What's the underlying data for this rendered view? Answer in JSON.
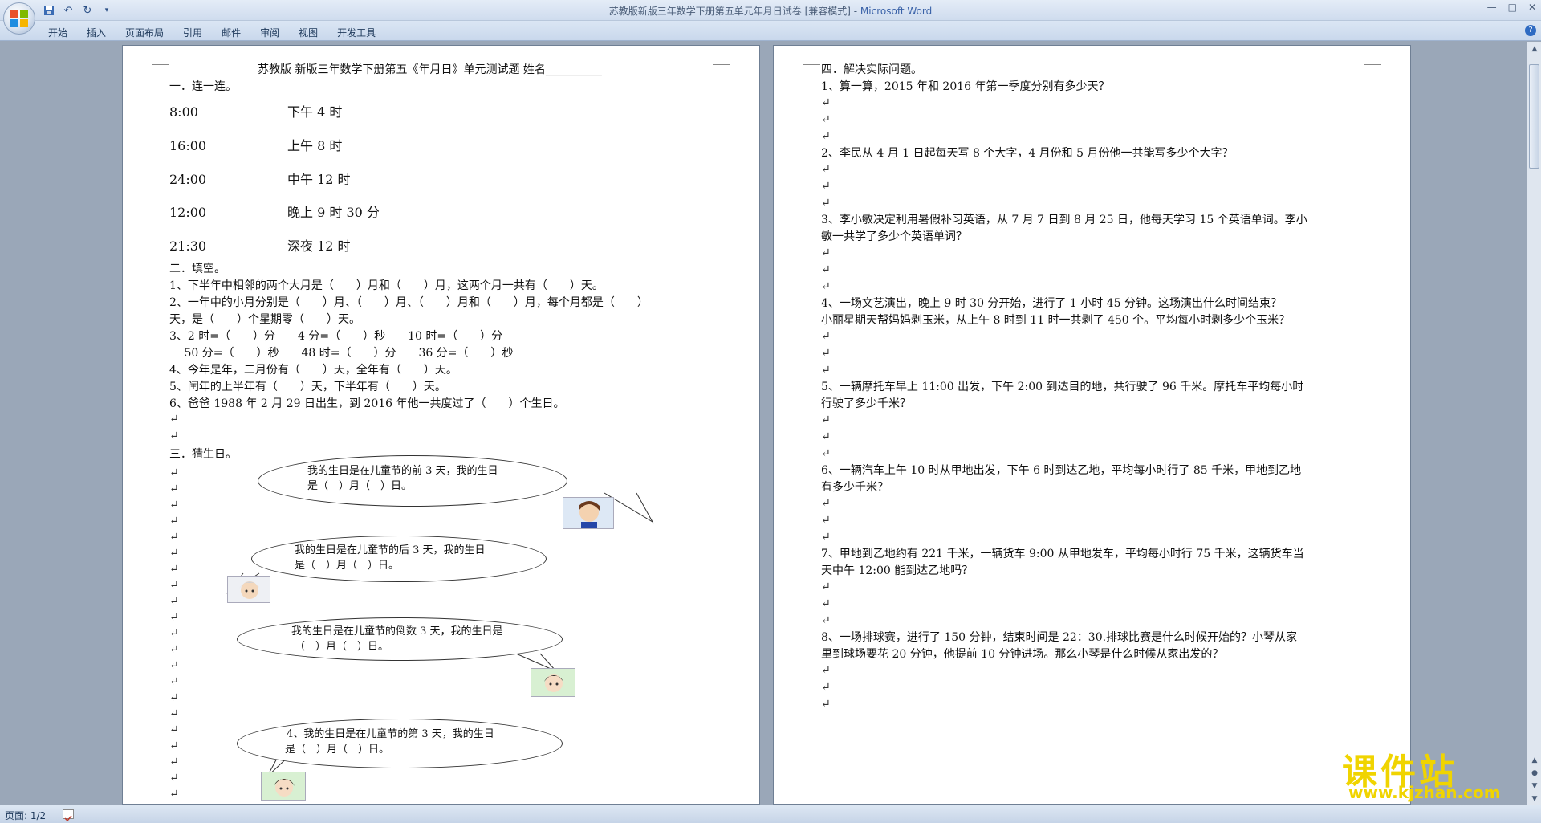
{
  "window": {
    "title_doc": "苏教版新版三年数学下册第五单元年月日试卷 [兼容模式] - ",
    "title_app": "Microsoft Word",
    "controls": [
      "—",
      "□",
      "✕"
    ]
  },
  "ribbon": {
    "tabs": [
      "开始",
      "插入",
      "页面布局",
      "引用",
      "邮件",
      "审阅",
      "视图",
      "开发工具"
    ]
  },
  "page1": {
    "title": "苏教版 新版三年数学下册第五《年月日》单元测试题      姓名__________",
    "sec1": "一．连一连。",
    "match_left": [
      "8:00",
      "16:00",
      "24:00",
      "12:00",
      "21:30"
    ],
    "match_right": [
      "下午 4 时",
      "上午 8 时",
      "中午 12 时",
      "晚上 9 时 30 分",
      "深夜 12 时"
    ],
    "sec2": "二．填空。",
    "fill": [
      "1、下半年中相邻的两个大月是（　　）月和（　　）月，这两个月一共有（　　）天。",
      "2、一年中的小月分别是（　　）月、（　　）月、（　　）月和（　　）月，每个月都是（　　）",
      "天，是（　　）个星期零（　　）天。",
      "3、2 时=（　　）分　　4 分=（　　）秒　　10 时=（　　）分",
      "　 50 分=（　　）秒　　48 时=（　　）分　　36 分=（　　）秒",
      "4、今年是年，二月份有（　　）天，全年有（　　）天。",
      "5、闰年的上半年有（　　）天，下半年有（　　）天。",
      "6、爸爸 1988 年 2 月 29 日出生，到 2016 年他一共度过了（　　）个生日。"
    ],
    "sec3": "三．猜生日。",
    "bubbles": [
      [
        "我的生日是在儿童节的前 3 天，我的生日",
        "是（　）月（　）日。"
      ],
      [
        "我的生日是在儿童节的后  3 天，我的生日",
        "是（　）月（　）日。"
      ],
      [
        "我的生日是在儿童节的倒数 3 天，我的生日是",
        "（　）月（　）日。"
      ],
      [
        "4、我的生日是在儿童节的第  3 天，我的生日",
        "是（　）月（　）日。"
      ]
    ]
  },
  "page2": {
    "sec4": "四．解决实际问题。",
    "questions": [
      [
        "1、算一算，2015 年和 2016 年第一季度分别有多少天？"
      ],
      [
        "2、李民从 4 月 1 日起每天写 8 个大字，4 月份和 5 月份他一共能写多少个大字？"
      ],
      [
        "3、李小敏决定利用暑假补习英语，从 7 月 7 日到 8 月 25 日，他每天学习 15 个英语单词。李小",
        "敏一共学了多少个英语单词？"
      ],
      [
        "4、一场文艺演出，晚上 9 时 30 分开始，进行了 1 小时 45 分钟。这场演出什么时间结束？",
        "小丽星期天帮妈妈剥玉米，从上午 8 时到 11 时一共剥了 450 个。平均每小时剥多少个玉米？"
      ],
      [
        "5、一辆摩托车早上 11:00 出发，下午 2:00 到达目的地，共行驶了 96 千米。摩托车平均每小时",
        "行驶了多少千米？"
      ],
      [
        "6、一辆汽车上午 10 时从甲地出发，下午 6 时到达乙地，平均每小时行了 85 千米，甲地到乙地",
        "有多少千米？"
      ],
      [
        "7、甲地到乙地约有 221 千米，一辆货车 9:00 从甲地发车，平均每小时行 75 千米，这辆货车当",
        "天中午 12:00 能到达乙地吗？"
      ],
      [
        "8、一场排球赛，进行了 150 分钟，结束时间是 22：30.排球比赛是什么时候开始的？小琴从家",
        "里到球场要花 20 分钟，他提前 10 分钟进场。那么小琴是什么时候从家出发的？"
      ]
    ]
  },
  "status": {
    "page": "页面: 1/2"
  },
  "watermark": {
    "text": "课件站",
    "url": "www.kjzhan.com"
  },
  "paragraph_mark": "↵"
}
